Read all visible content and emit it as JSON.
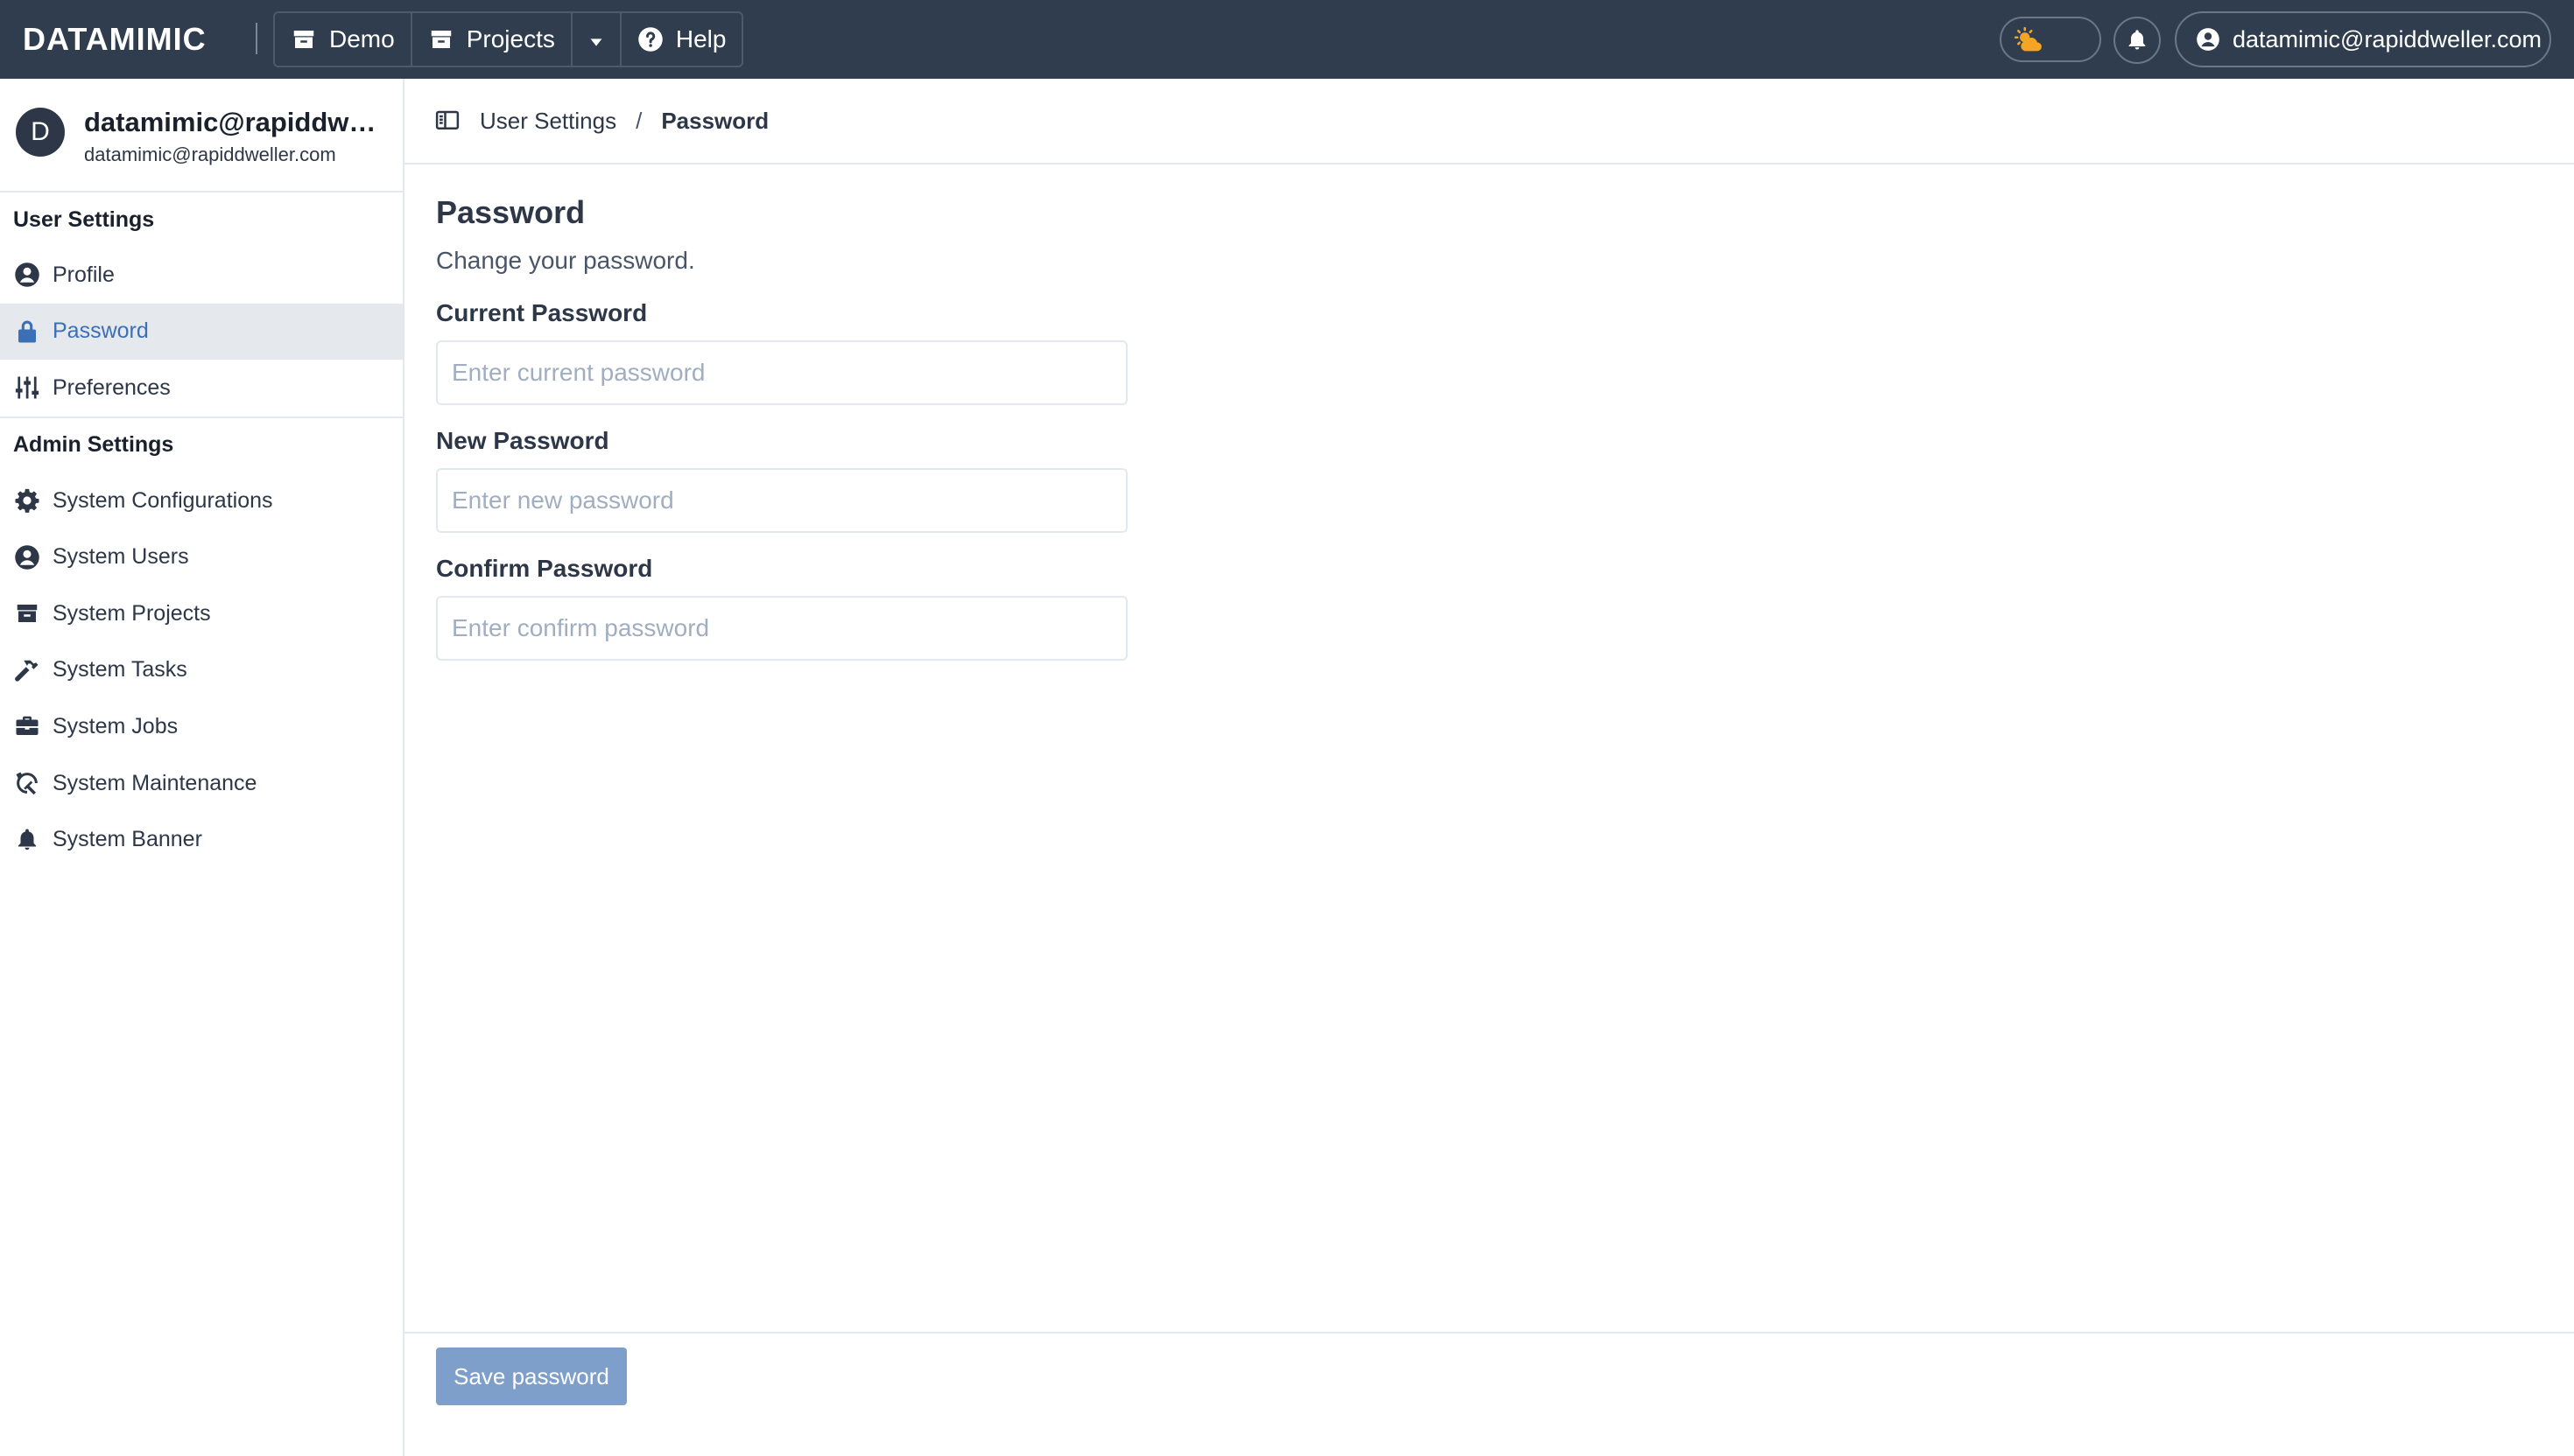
{
  "topbar": {
    "logo": "DATAMIMIC",
    "nav": [
      {
        "label": "Demo",
        "icon": "archive-icon"
      },
      {
        "label": "Projects",
        "icon": "archive-icon"
      },
      {
        "label": "",
        "icon": "caret-down-icon"
      },
      {
        "label": "Help",
        "icon": "question-circle-icon"
      }
    ],
    "user_label": "datamimic@rapiddweller.com",
    "colors": {
      "bar": "#2f3d4e",
      "theme_icon": "#f5a524"
    }
  },
  "sidebar": {
    "avatar_initial": "D",
    "profile_name": "datamimic@rapiddwel...",
    "profile_email": "datamimic@rapiddweller.com",
    "user_section_title": "User Settings",
    "user_items": [
      {
        "label": "Profile",
        "icon": "user-circle-icon",
        "active": false
      },
      {
        "label": "Password",
        "icon": "lock-icon",
        "active": true
      },
      {
        "label": "Preferences",
        "icon": "sliders-icon",
        "active": false
      }
    ],
    "admin_section_title": "Admin Settings",
    "admin_items": [
      {
        "label": "System Configurations",
        "icon": "gear-icon"
      },
      {
        "label": "System Users",
        "icon": "user-circle-icon"
      },
      {
        "label": "System Projects",
        "icon": "archive-icon"
      },
      {
        "label": "System Tasks",
        "icon": "hammer-icon"
      },
      {
        "label": "System Jobs",
        "icon": "briefcase-icon"
      },
      {
        "label": "System Maintenance",
        "icon": "maintenance-icon"
      },
      {
        "label": "System Banner",
        "icon": "bell-icon"
      }
    ],
    "active_color": "#3b6fb6"
  },
  "breadcrumb": {
    "parent": "User Settings",
    "separator": "/",
    "current": "Password"
  },
  "main": {
    "title": "Password",
    "subtitle": "Change your password.",
    "fields": [
      {
        "label": "Current Password",
        "placeholder": "Enter current password",
        "value": ""
      },
      {
        "label": "New Password",
        "placeholder": "Enter new password",
        "value": ""
      },
      {
        "label": "Confirm Password",
        "placeholder": "Enter confirm password",
        "value": ""
      }
    ],
    "save_label": "Save password",
    "save_color": "#7d9fc9"
  }
}
